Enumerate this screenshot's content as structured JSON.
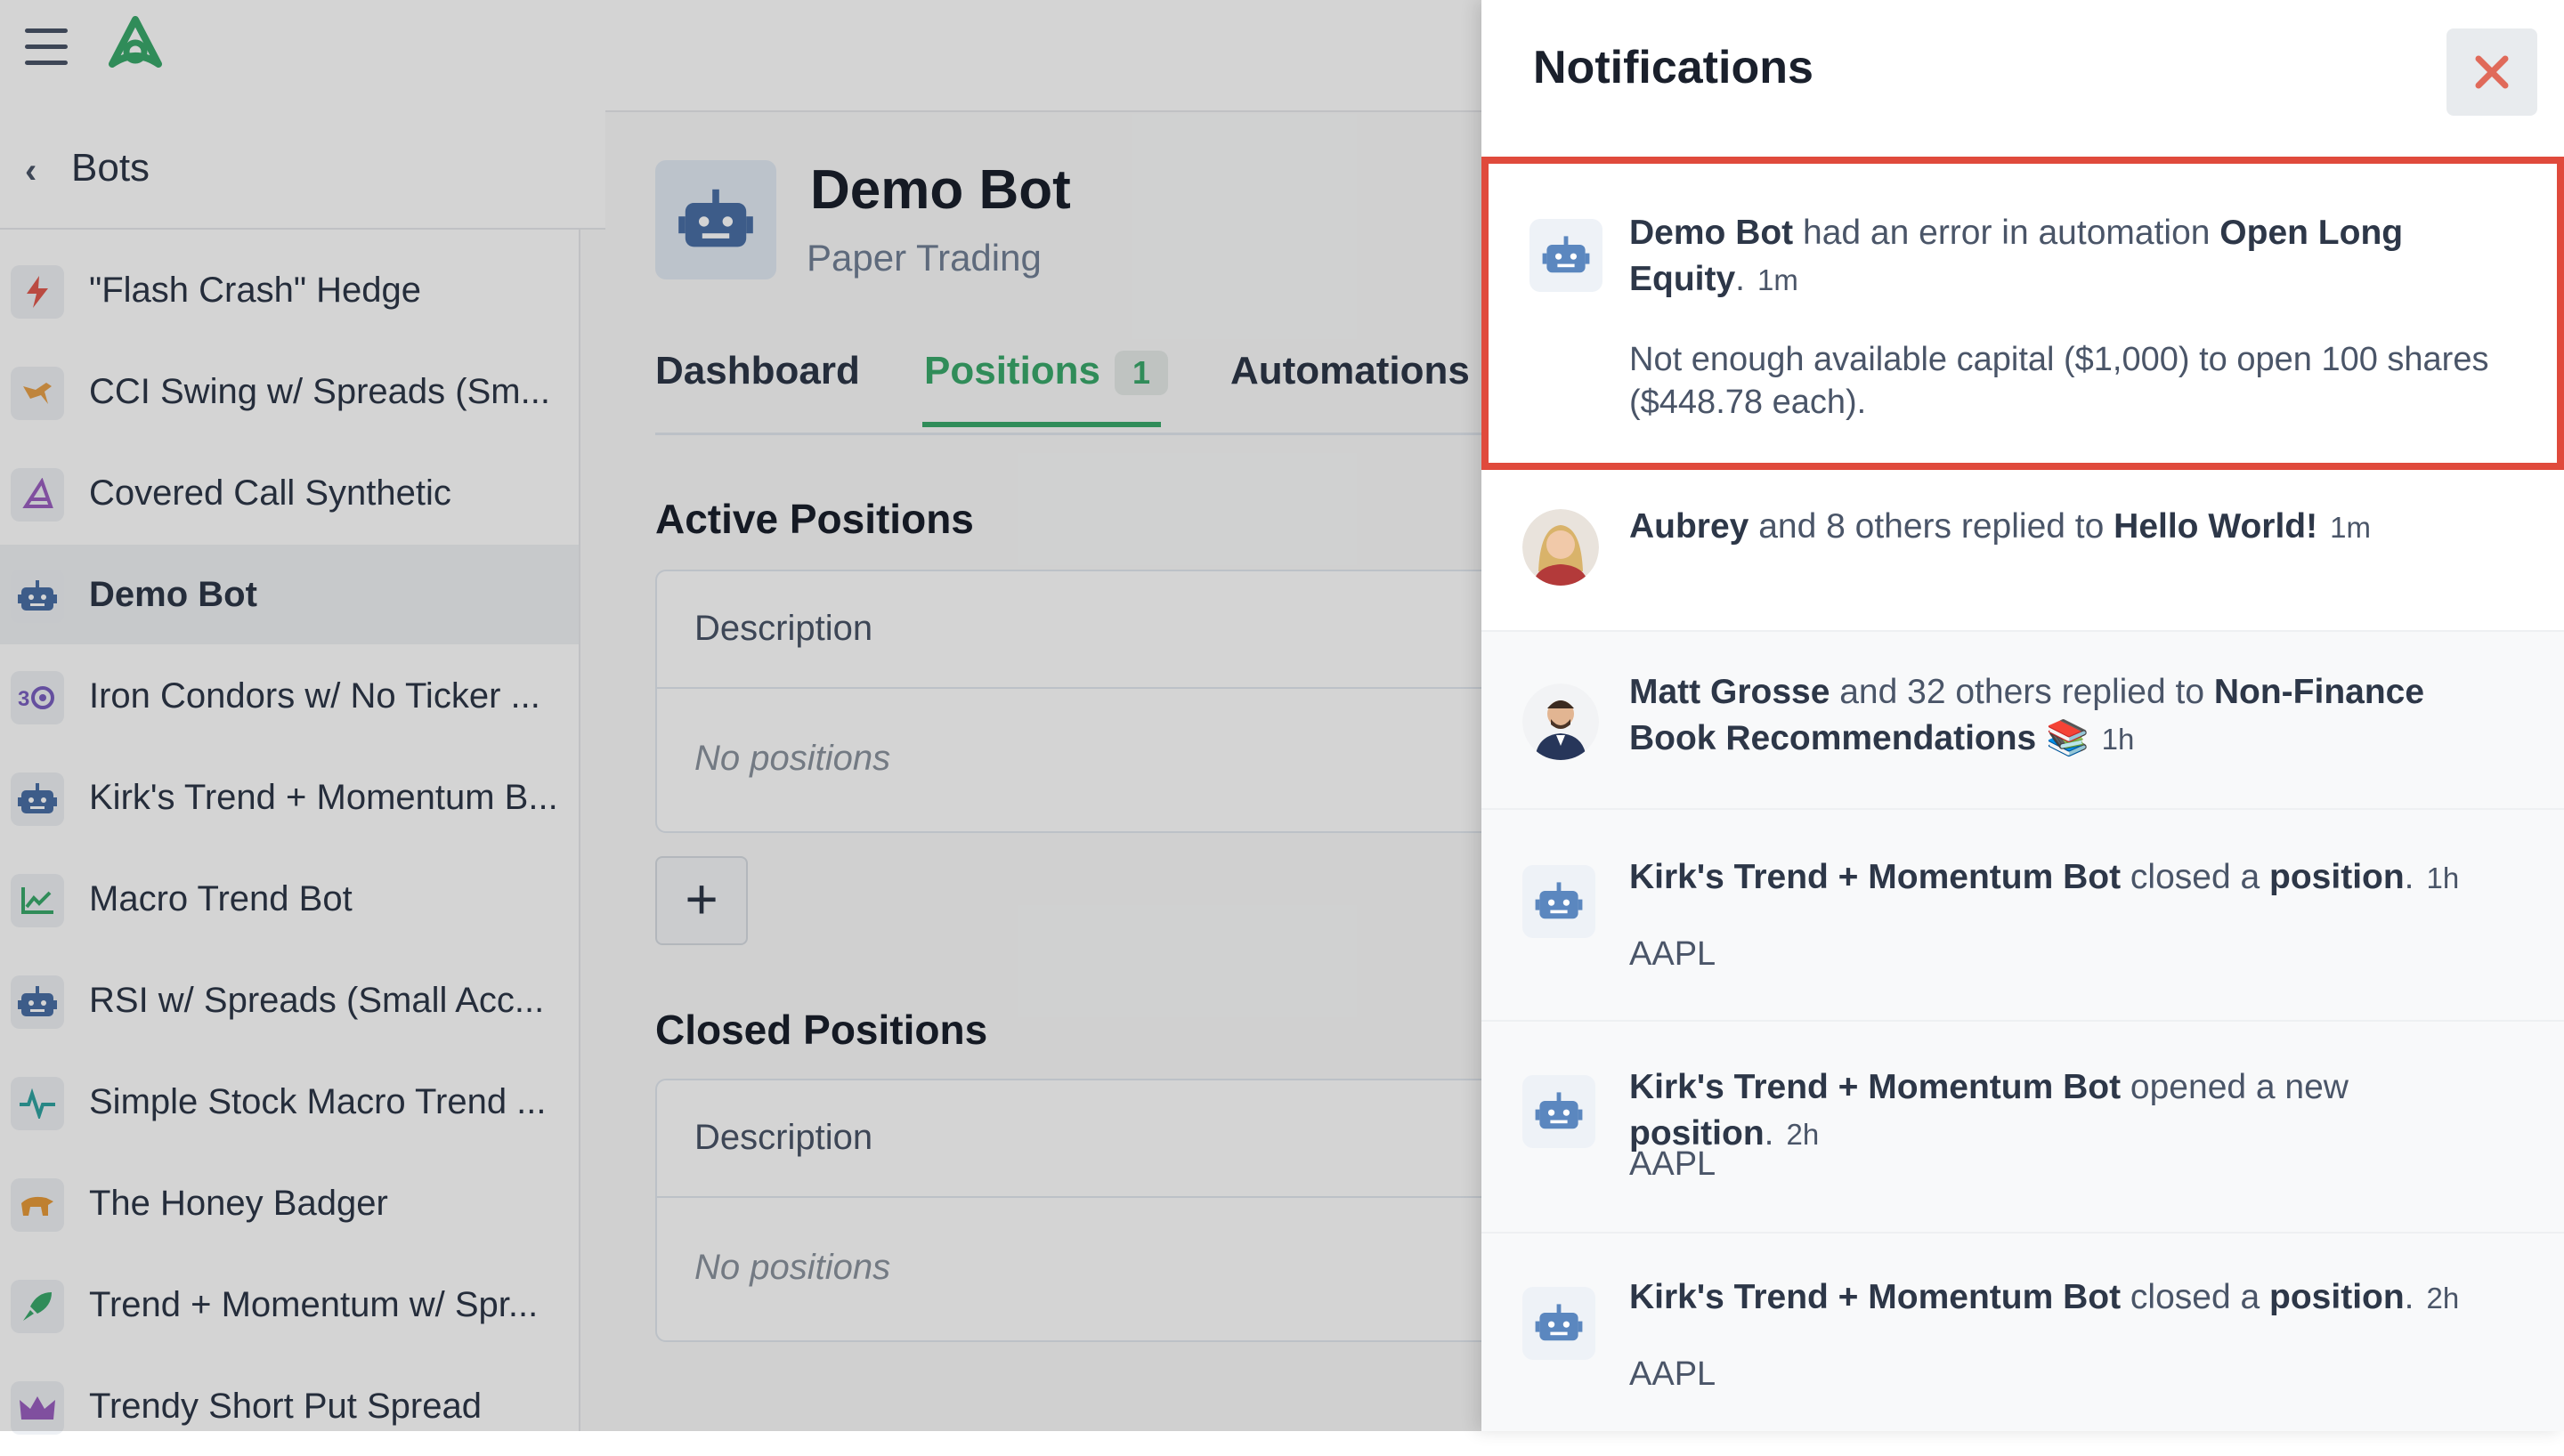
{
  "nav": {
    "back_label": "Bots"
  },
  "colors": {
    "accent": "#3aa96b",
    "highlight_border": "#e04a3c",
    "close_x": "#e06a5a"
  },
  "sidebar": {
    "items": [
      {
        "label": "\"Flash Crash\" Hedge",
        "icon": "lightning-icon",
        "color": "#e05a4f"
      },
      {
        "label": "CCI Swing w/ Spreads (Sm...",
        "icon": "bird-icon",
        "color": "#e6a04a"
      },
      {
        "label": "Covered Call Synthetic",
        "icon": "wizard-hat-icon",
        "color": "#9b5fc0"
      },
      {
        "label": "Demo Bot",
        "icon": "robot-icon",
        "color": "#4a6fa5",
        "active": true
      },
      {
        "label": "Iron Condors w/ No Ticker ...",
        "icon": "condor-icon",
        "color": "#7a5fc0"
      },
      {
        "label": "Kirk's Trend + Momentum B...",
        "icon": "robot-icon",
        "color": "#4a6fa5"
      },
      {
        "label": "Macro Trend Bot",
        "icon": "line-chart-icon",
        "color": "#3aa96b"
      },
      {
        "label": "RSI w/ Spreads (Small Acc...",
        "icon": "robot-icon",
        "color": "#4a6fa5"
      },
      {
        "label": "Simple Stock Macro Trend ...",
        "icon": "pulse-icon",
        "color": "#2fa3a0"
      },
      {
        "label": "The Honey Badger",
        "icon": "badger-icon",
        "color": "#e69a3a"
      },
      {
        "label": "Trend + Momentum w/ Spr...",
        "icon": "rocket-icon",
        "color": "#3aa96b"
      },
      {
        "label": "Trendy Short Put Spread",
        "icon": "crown-icon",
        "color": "#9b5fc0"
      }
    ]
  },
  "main": {
    "title": "Demo Bot",
    "subtitle": "Paper Trading",
    "tabs": [
      {
        "label": "Dashboard"
      },
      {
        "label": "Positions",
        "count": "1",
        "active": true
      },
      {
        "label": "Automations"
      }
    ],
    "active_positions": {
      "title": "Active Positions",
      "column": "Description",
      "empty": "No positions"
    },
    "closed_positions": {
      "title": "Closed Positions",
      "column": "Description",
      "empty": "No positions"
    },
    "add_label": "+"
  },
  "notifications": {
    "title": "Notifications",
    "items": [
      {
        "actor": "Demo Bot",
        "text": " had an error in automation ",
        "target": "Open Long Equity",
        "suffix": ".",
        "time": "1m",
        "detail": "Not enough available capital ($1,000) to open 100 shares ($448.78 each).",
        "icon": "robot-icon"
      },
      {
        "actor": "Aubrey",
        "text": " and 8 others replied to ",
        "target": "Hello World!",
        "suffix": "",
        "time": "1m",
        "icon": "avatar-aubrey"
      },
      {
        "actor": "Matt Grosse",
        "text": " and 32 others replied to ",
        "target": "Non-Finance Book Recommendations",
        "suffix": " 📚",
        "time": "1h",
        "icon": "avatar-matt"
      },
      {
        "actor": "Kirk's Trend + Momentum Bot",
        "text": " closed a ",
        "target": "position",
        "suffix": ".",
        "time": "1h",
        "detail": "AAPL",
        "icon": "robot-icon"
      },
      {
        "actor": "Kirk's Trend + Momentum Bot",
        "text": " opened a new ",
        "target": "position",
        "suffix": ".",
        "time": "2h",
        "detail": "AAPL",
        "icon": "robot-icon"
      },
      {
        "actor": "Kirk's Trend + Momentum Bot",
        "text": " closed a ",
        "target": "position",
        "suffix": ".",
        "time": "2h",
        "detail": "AAPL",
        "icon": "robot-icon"
      }
    ]
  }
}
